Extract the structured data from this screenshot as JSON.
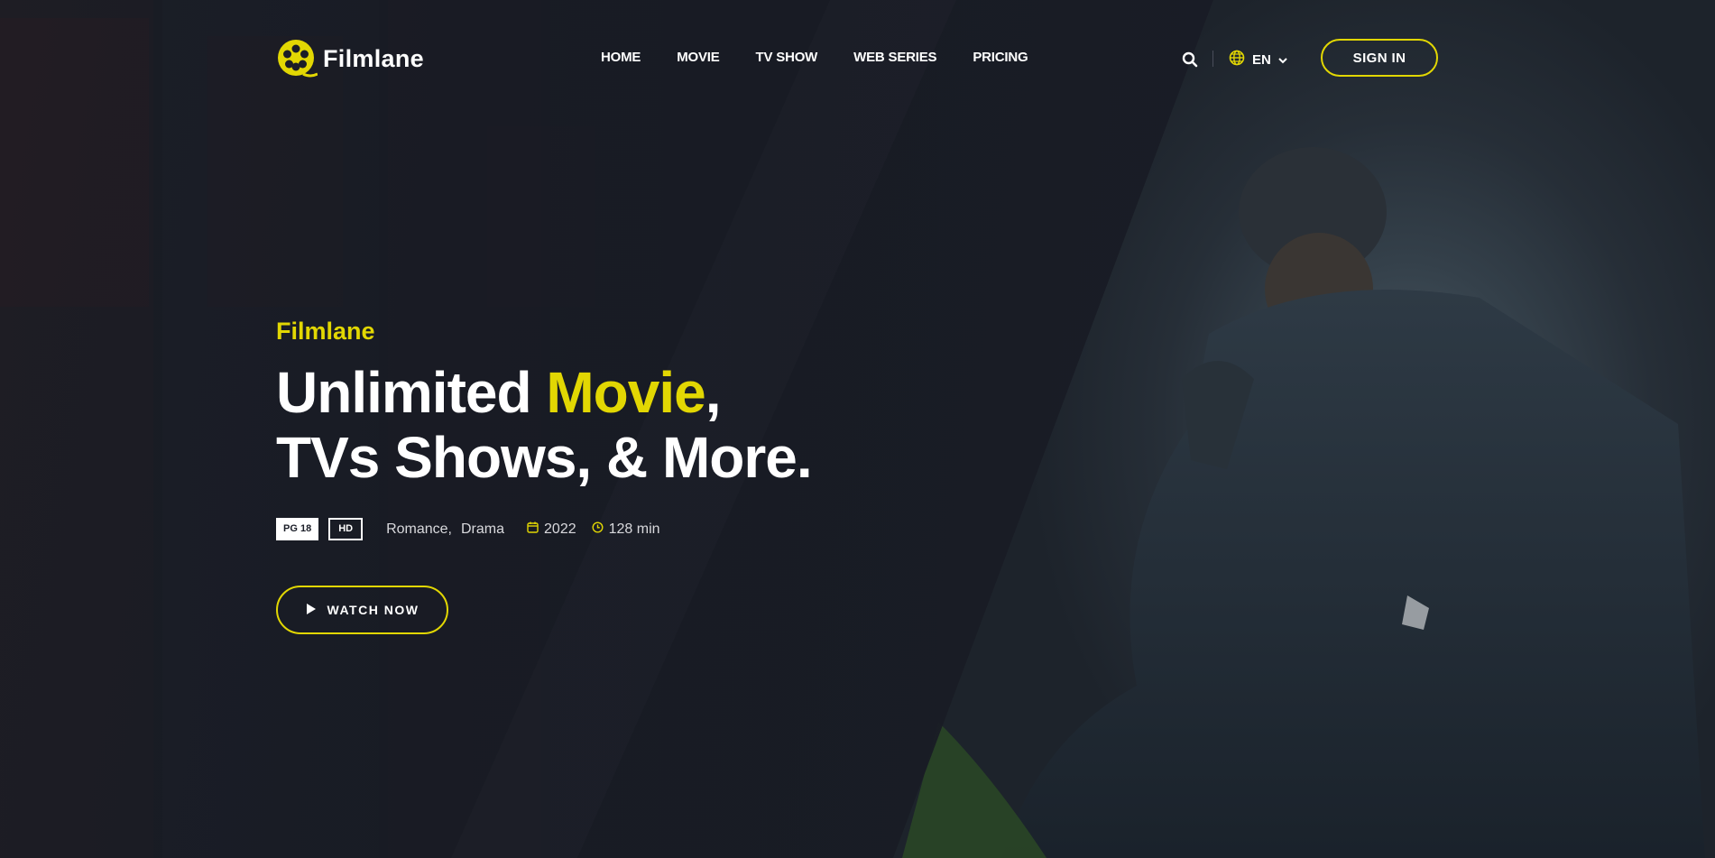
{
  "brand": {
    "name": "Filmlane",
    "accent_color": "#e2d703",
    "background_color": "#1a1d27",
    "logo_icon": "film-reel-icon"
  },
  "nav": {
    "items": [
      {
        "label": "HOME"
      },
      {
        "label": "MOVIE"
      },
      {
        "label": "TV SHOW"
      },
      {
        "label": "WEB SERIES"
      },
      {
        "label": "PRICING"
      }
    ]
  },
  "header_actions": {
    "search_icon": "search-icon",
    "language_icon": "globe-icon",
    "language": "EN",
    "language_chevron": "chevron-down-icon",
    "signin_label": "SIGN IN"
  },
  "hero": {
    "subtitle": "Filmlane",
    "title_part1": "Unlimited ",
    "title_accent": "Movie",
    "title_part2": ",",
    "title_line2": "TVs Shows, & More.",
    "badges": [
      "PG 18",
      "HD"
    ],
    "genres": [
      "Romance,",
      "Drama"
    ],
    "year": "2022",
    "duration": "128 min",
    "watch_label": "WATCH NOW",
    "watch_icon": "play-icon"
  }
}
